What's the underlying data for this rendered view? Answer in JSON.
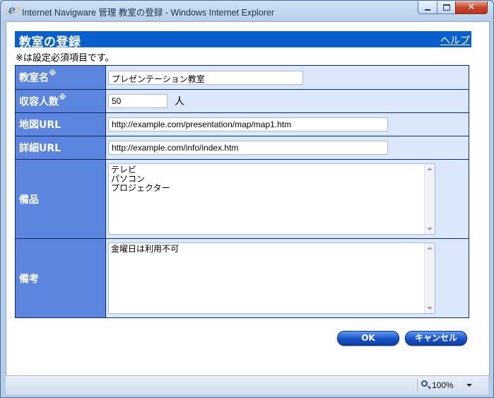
{
  "window": {
    "title": "Internet Navigware 管理 教室の登録 - Windows Internet Explorer",
    "icon": "ie-icon",
    "close_glyph": "✕"
  },
  "dialog": {
    "title": "教室の登録",
    "help_label": "ヘルプ",
    "required_note": "※は設定必須項目です。"
  },
  "form": {
    "name_label": "教室名",
    "name_mark": "※",
    "name_value": "プレゼンテーション教室",
    "capacity_label": "収容人数",
    "capacity_mark": "※",
    "capacity_value": "50",
    "capacity_unit": "人",
    "map_url_label": "地図URL",
    "map_url_value": "http://example.com/presentation/map/map1.htm",
    "detail_url_label": "詳細URL",
    "detail_url_value": "http://example.com/info/index.htm",
    "equipment_label": "備品",
    "equipment_lines": [
      "テレビ",
      "パソコン",
      "プロジェクター"
    ],
    "notes_label": "備考",
    "notes_lines": [
      "金曜日は利用不可"
    ]
  },
  "buttons": {
    "ok_label": "OK",
    "cancel_label": "キャンセル"
  },
  "statusbar": {
    "zoom": "100%"
  },
  "colors": {
    "header_bar": "#0a5fcf",
    "label_cell": "#5c85e0",
    "value_cell": "#dbe8fb"
  }
}
